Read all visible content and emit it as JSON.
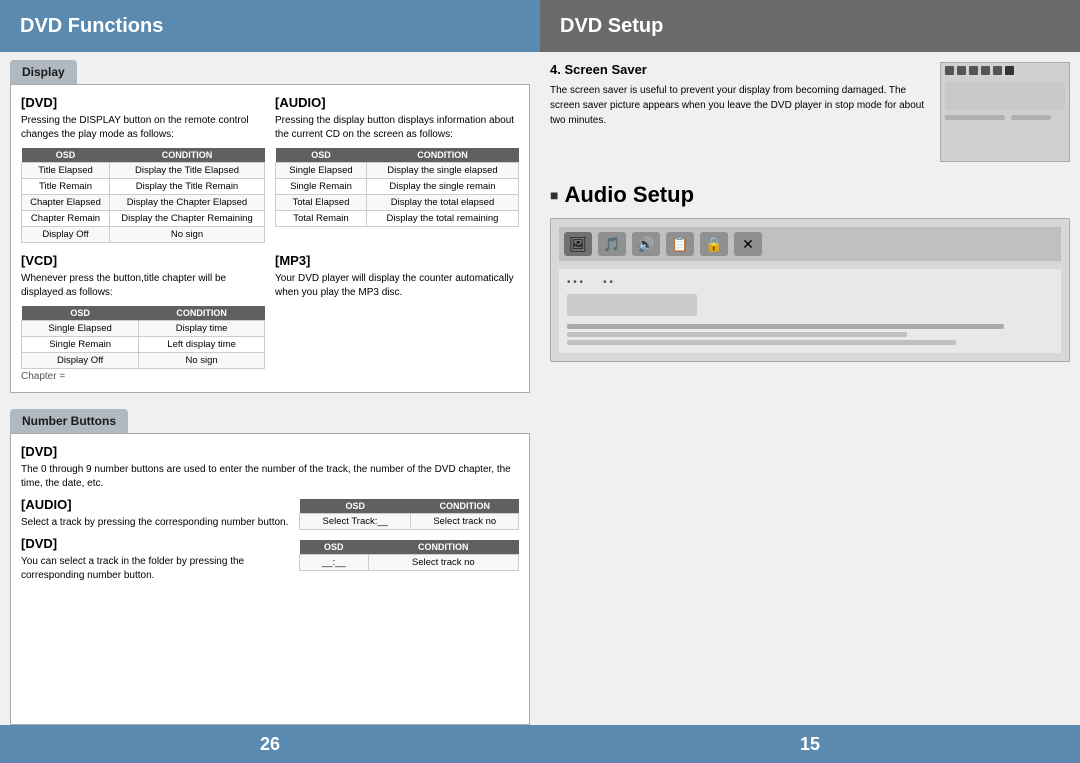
{
  "left": {
    "header": "DVD Functions",
    "footer": "26",
    "display_tab": "Display",
    "dvd_heading": "[DVD]",
    "dvd_text": "Pressing the DISPLAY button on the remote control changes the play mode as follows:",
    "audio_heading": "[AUDIO]",
    "audio_text": "Pressing the display button displays information about the current CD on the screen as follows:",
    "vcd_heading": "[VCD]",
    "vcd_text": "Whenever press the button,title chapter will be displayed as follows:",
    "mp3_heading": "[MP3]",
    "mp3_text": "Your DVD player will display the counter automatically when you play the MP3 disc.",
    "dvd_table": {
      "headers": [
        "OSD",
        "CONDITION"
      ],
      "rows": [
        [
          "Title Elapsed",
          "Display the Title Elapsed"
        ],
        [
          "Title Remain",
          "Display the Title Remain"
        ],
        [
          "Chapter Elapsed",
          "Display the Chapter Elapsed"
        ],
        [
          "Chapter Remain",
          "Display the Chapter Remaining"
        ],
        [
          "Display Off",
          "No sign"
        ]
      ]
    },
    "audio_table": {
      "headers": [
        "OSD",
        "CONDITION"
      ],
      "rows": [
        [
          "Single Elapsed",
          "Display the single elapsed"
        ],
        [
          "Single Remain",
          "Display the single remain"
        ],
        [
          "Total Elapsed",
          "Display the total elapsed"
        ],
        [
          "Total Remain",
          "Display the total remaining"
        ]
      ]
    },
    "vcd_table": {
      "headers": [
        "OSD",
        "CONDITION"
      ],
      "rows": [
        [
          "Single Elapsed",
          "Display time"
        ],
        [
          "Single Remain",
          "Left display time"
        ],
        [
          "Display Off",
          "No sign"
        ]
      ]
    },
    "number_buttons_tab": "Number Buttons",
    "num_dvd_heading": "[DVD]",
    "num_dvd_text": "The 0 through 9 number buttons are used to enter the number of the track, the number of the DVD chapter, the time, the date, etc.",
    "num_audio_heading": "[AUDIO]",
    "num_audio_text": "Select a track by pressing the corresponding number button.",
    "num_dvd2_heading": "[DVD]",
    "num_dvd2_text": "You can select a track in the folder by pressing the corresponding number button.",
    "audio_osd_table": {
      "headers": [
        "OSD",
        "CONDITION"
      ],
      "rows": [
        [
          "Select Track:__",
          "Select track no"
        ]
      ]
    },
    "dvd2_osd_table": {
      "headers": [
        "OSD",
        "CONDITION"
      ],
      "rows": [
        [
          "__:__",
          "Select track no"
        ]
      ]
    },
    "chapter_eq": "Chapter ="
  },
  "right": {
    "header": "DVD Setup",
    "footer": "15",
    "screen_saver_num": "4.",
    "screen_saver_title": "Screen Saver",
    "screen_saver_text": "The screen saver is useful to prevent your display from becoming damaged. The screen saver picture appears when you leave the DVD player in stop mode for about two minutes.",
    "audio_setup_title": "Audio Setup",
    "icons": [
      "🖼",
      "🎵",
      "🔊",
      "📋",
      "🔒",
      "✕"
    ],
    "mock_dots_left": "• • •",
    "mock_dots_right": "• •"
  }
}
